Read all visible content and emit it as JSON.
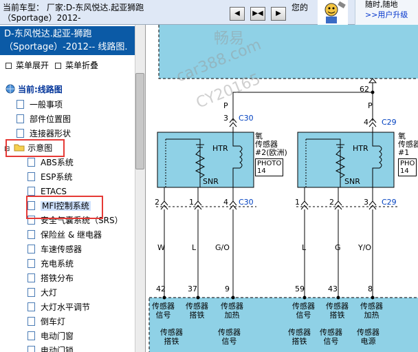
{
  "header": {
    "car_line1": "当前车型：  厂家:D-东风悦达.起亚狮跑",
    "car_line2": "（Sportage）2012-",
    "nav_buttons": [
      "◀",
      "▶◀",
      "▶"
    ],
    "mascot_text": "您的",
    "ad_text": "随时,随地",
    "ad_link": ">>用户升级"
  },
  "sidebar": {
    "doc_title_line1": "D-东风悦达.起亚-狮跑",
    "doc_title_line2": "（Sportage）-2012-- 线路图.",
    "expand_label": "菜单展开",
    "collapse_label": "菜单折叠",
    "current_label": "当前:线路图",
    "items": [
      "一般事项",
      "部件位置图",
      "连接器形状",
      "示意图",
      "ABS系统",
      "ESP系统",
      "ETACS",
      "MFI控制系统",
      "安全气囊系统（SRS）",
      "保险丝 & 继电器",
      "车速传感器",
      "充电系统",
      "搭铁分布",
      "大灯",
      "大灯水平调节",
      "倒车灯",
      "电动门窗",
      "电动门锁"
    ]
  },
  "diagram": {
    "watermark1": "畅易",
    "watermark2": "car388.com",
    "watermark3": "CY20165",
    "wire_num_top": "62",
    "left_sensor": {
      "pin_top_num": "3",
      "connector_top": "C30",
      "wire_color_top": "P",
      "name_line1": "氧",
      "name_line2": "传感器",
      "name_line3": "#2(欧洲)",
      "photo": "PHOTO",
      "photo_num": "14",
      "htr": "HTR",
      "snr": "SNR",
      "pin_bottom_a": "2",
      "pin_bottom_b": "1",
      "pin_bottom_c": "4",
      "connector_bottom": "C30",
      "wire_a": "W",
      "wire_b": "L",
      "wire_c": "G/O",
      "ecm_pin_a": "42",
      "ecm_pin_b": "37",
      "ecm_pin_c": "9"
    },
    "right_sensor": {
      "pin_top_num": "4",
      "connector_top": "C29",
      "wire_color_top": "P",
      "name_line1": "氧",
      "name_line2": "传感器",
      "name_line3": "#1",
      "photo": "PHO",
      "photo_num": "14",
      "htr": "HTR",
      "snr": "SNR",
      "pin_bottom_a": "1",
      "pin_bottom_b": "2",
      "pin_bottom_c": "3",
      "connector_bottom": "C29",
      "wire_a": "L",
      "wire_b": "G",
      "wire_c": "Y/O",
      "ecm_pin_a": "59",
      "ecm_pin_b": "43",
      "ecm_pin_c": "8"
    },
    "ecm_labels_row1": [
      [
        "传感器",
        "信号"
      ],
      [
        "传感器",
        "搭铁"
      ],
      [
        "传感器",
        "加热"
      ],
      [
        "传感器",
        "信号"
      ],
      [
        "传感器",
        "搭铁"
      ],
      [
        "传感器",
        "加热"
      ]
    ],
    "ecm_labels_row2": [
      [
        "传感器",
        "搭铁"
      ],
      [
        "传感器",
        "信号"
      ],
      [
        "传感器",
        "搭铁"
      ],
      [
        "传感器",
        "信号"
      ],
      [
        "传感器",
        "电源"
      ]
    ],
    "colors": {
      "sensor_fill": "#8fd1e6",
      "ecm_fill": "#8fd1e6",
      "connector_blue": "#0040c0"
    }
  }
}
